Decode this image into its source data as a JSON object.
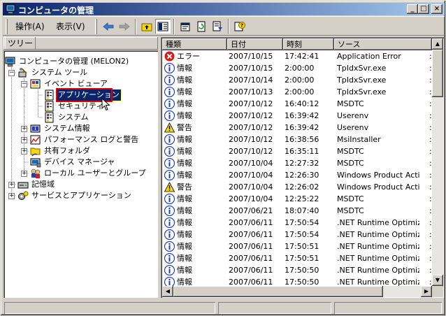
{
  "window": {
    "title": "コンピュータの管理",
    "buttons": {
      "minimize": "_",
      "maximize": "□",
      "close": "×"
    }
  },
  "menu": [
    {
      "label": "操作(A)"
    },
    {
      "label": "表示(V)"
    }
  ],
  "tree": {
    "tab_label": "ツリー",
    "nodes": [
      {
        "label": "コンピュータの管理 (MELON2)",
        "icon": "computer-icon"
      },
      {
        "label": "システム ツール",
        "icon": "tools-icon"
      },
      {
        "label": "イベント ビューア",
        "icon": "event-viewer-icon"
      },
      {
        "label": "アプリケーション",
        "icon": "log-icon"
      },
      {
        "label": "セキュリティ",
        "icon": "log-icon"
      },
      {
        "label": "システム",
        "icon": "log-icon"
      },
      {
        "label": "システム情報",
        "icon": "system-info-icon"
      },
      {
        "label": "パフォーマンス ログと警告",
        "icon": "performance-icon"
      },
      {
        "label": "共有フォルダ",
        "icon": "shared-folder-icon"
      },
      {
        "label": "デバイス マネージャ",
        "icon": "device-manager-icon"
      },
      {
        "label": "ローカル ユーザーとグループ",
        "icon": "users-icon"
      },
      {
        "label": "記憶域",
        "icon": "storage-icon"
      },
      {
        "label": "サービスとアプリケーション",
        "icon": "services-icon"
      }
    ]
  },
  "list": {
    "columns": [
      "種類",
      "日付",
      "時刻",
      "ソース"
    ],
    "rows": [
      {
        "kind": "error",
        "type": "エラー",
        "date": "2007/10/15",
        "time": "17:42:41",
        "source": "Application Error"
      },
      {
        "kind": "info",
        "type": "情報",
        "date": "2007/10/15",
        "time": "2:00:00",
        "source": "TpIdxSvr.exe"
      },
      {
        "kind": "info",
        "type": "情報",
        "date": "2007/10/14",
        "time": "2:00:00",
        "source": "TpIdxSvr.exe"
      },
      {
        "kind": "info",
        "type": "情報",
        "date": "2007/10/13",
        "time": "2:00:00",
        "source": "TpIdxSvr.exe"
      },
      {
        "kind": "info",
        "type": "情報",
        "date": "2007/10/12",
        "time": "16:40:12",
        "source": "MSDTC"
      },
      {
        "kind": "info",
        "type": "情報",
        "date": "2007/10/12",
        "time": "16:39:42",
        "source": "Userenv"
      },
      {
        "kind": "warning",
        "type": "警告",
        "date": "2007/10/12",
        "time": "16:39:42",
        "source": "Userenv"
      },
      {
        "kind": "info",
        "type": "情報",
        "date": "2007/10/12",
        "time": "16:38:56",
        "source": "MsiInstaller"
      },
      {
        "kind": "info",
        "type": "情報",
        "date": "2007/10/12",
        "time": "16:35:11",
        "source": "MSDTC"
      },
      {
        "kind": "info",
        "type": "情報",
        "date": "2007/10/04",
        "time": "12:27:32",
        "source": "MSDTC"
      },
      {
        "kind": "info",
        "type": "情報",
        "date": "2007/10/04",
        "time": "12:26:30",
        "source": "Windows Product Acti..."
      },
      {
        "kind": "warning",
        "type": "警告",
        "date": "2007/10/04",
        "time": "12:26:02",
        "source": "Windows Product Acti..."
      },
      {
        "kind": "info",
        "type": "情報",
        "date": "2007/10/04",
        "time": "12:25:22",
        "source": "MSDTC"
      },
      {
        "kind": "info",
        "type": "情報",
        "date": "2007/06/21",
        "time": "18:07:40",
        "source": "MSDTC"
      },
      {
        "kind": "info",
        "type": "情報",
        "date": "2007/06/11",
        "time": "17:50:54",
        "source": ".NET Runtime Optimiz..."
      },
      {
        "kind": "info",
        "type": "情報",
        "date": "2007/06/11",
        "time": "17:50:54",
        "source": ".NET Runtime Optimiz..."
      },
      {
        "kind": "info",
        "type": "情報",
        "date": "2007/06/11",
        "time": "17:50:51",
        "source": ".NET Runtime Optimiz..."
      },
      {
        "kind": "info",
        "type": "情報",
        "date": "2007/06/11",
        "time": "17:50:51",
        "source": ".NET Runtime Optimiz..."
      },
      {
        "kind": "info",
        "type": "情報",
        "date": "2007/06/11",
        "time": "17:50:50",
        "source": ".NET Runtime Optimiz..."
      },
      {
        "kind": "info",
        "type": "情報",
        "date": "2007/06/11",
        "time": "17:50:50",
        "source": ".NET Runtime Optimiz..."
      }
    ]
  },
  "colors": {
    "title_start": "#0a246a",
    "title_end": "#a6caf0",
    "selection": "#0a246a",
    "highlight_box": "#e00000",
    "info_icon": "#1c3fbf",
    "error_icon": "#d41c1c",
    "warning_icon": "#f5d800"
  }
}
